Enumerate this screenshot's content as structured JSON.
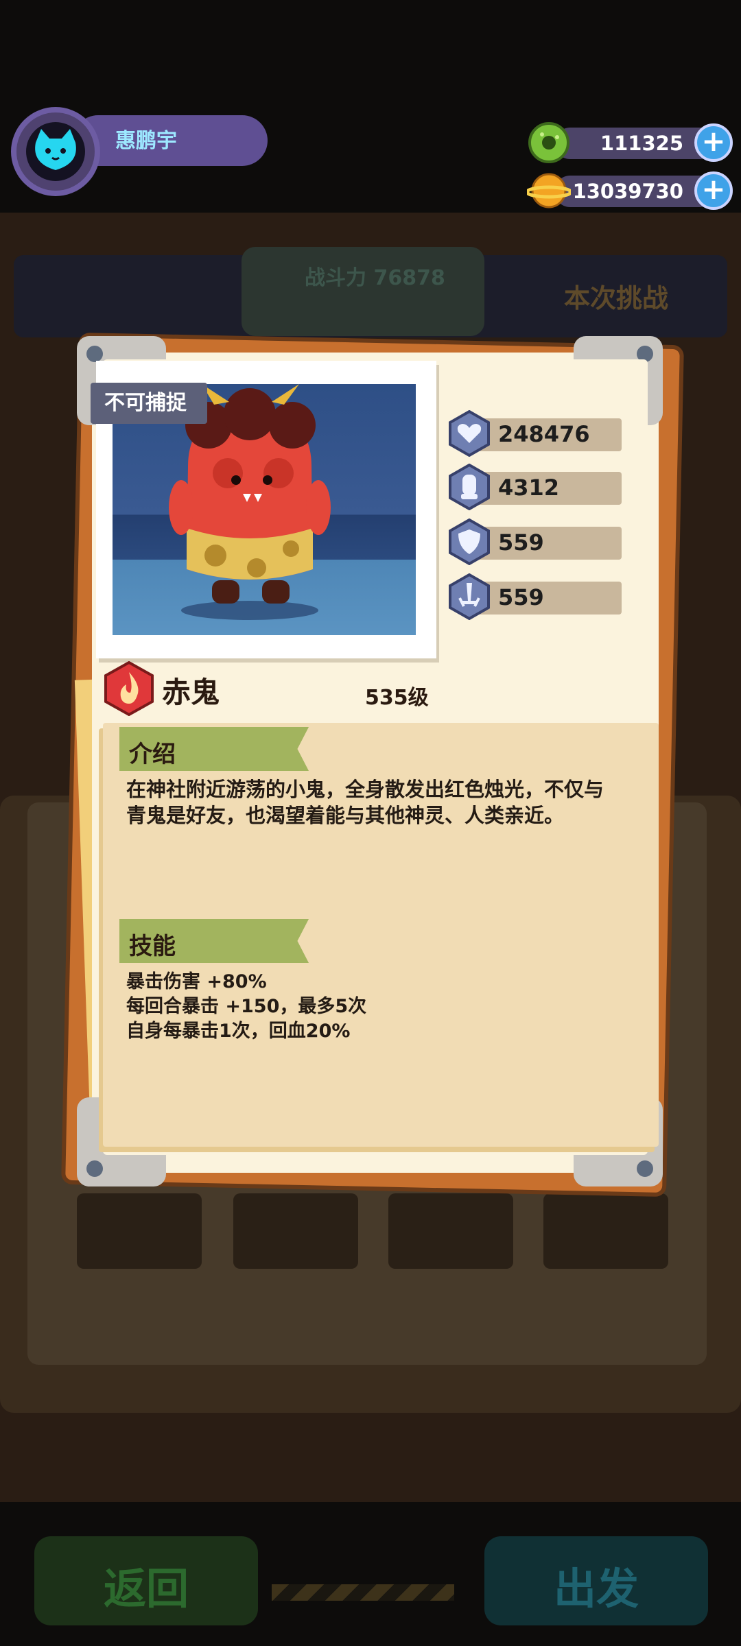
{
  "player": {
    "name": "惠鹏宇"
  },
  "currencies": [
    {
      "icon": "green-donut-coin-icon",
      "value": "111325"
    },
    {
      "icon": "orange-planet-coin-icon",
      "value": "13039730"
    }
  ],
  "background": {
    "power_label": "战斗力 76878",
    "challenge_label": "本次挑战",
    "back_button": "返回",
    "go_button": "出发"
  },
  "monster": {
    "capture_tag": "不可捕捉",
    "name": "赤鬼",
    "level": "535级",
    "element_icon": "fire-element-icon",
    "stats": [
      {
        "icon": "heart-hp-icon",
        "value": "248476"
      },
      {
        "icon": "fist-attack-icon",
        "value": "4312"
      },
      {
        "icon": "shield-defense-icon",
        "value": "559"
      },
      {
        "icon": "sword-pierce-icon",
        "value": "559"
      }
    ]
  },
  "intro": {
    "heading": "介绍",
    "text": "在神社附近游荡的小鬼，全身散发出红色烛光，不仅与青鬼是好友，也渴望着能与其他神灵、人类亲近。"
  },
  "skills": {
    "heading": "技能",
    "lines": [
      "暴击伤害 +80%",
      "每回合暴击 +150，最多5次",
      "自身每暴击1次，回血20%"
    ]
  },
  "colors": {
    "accent_green": "#a2b45e",
    "paper": "#fbf3dd",
    "panel": "#f1dcb4",
    "stat_bar": "#c9b79c"
  }
}
